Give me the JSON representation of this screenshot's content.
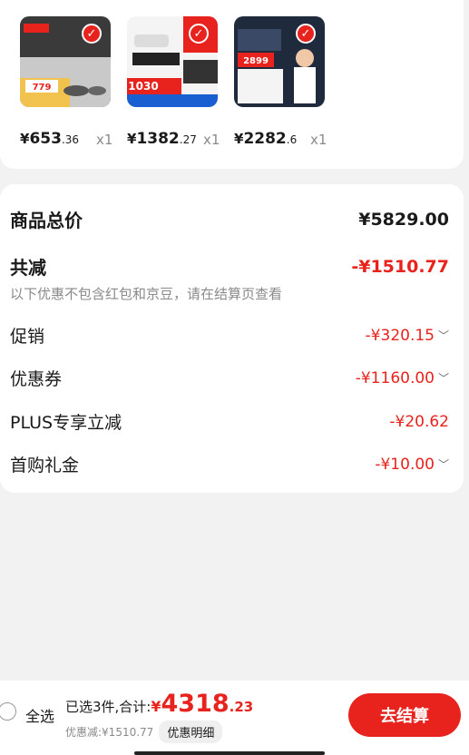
{
  "products": [
    {
      "cur": "¥",
      "int": "653",
      "dec": ".36",
      "qty": "x1",
      "thumb_label": "779"
    },
    {
      "cur": "¥",
      "int": "1382",
      "dec": ".27",
      "qty": "x1",
      "thumb_label": "1030"
    },
    {
      "cur": "¥",
      "int": "2282",
      "dec": ".6",
      "qty": "x1",
      "thumb_label": "2899"
    }
  ],
  "summary": {
    "total_label": "商品总价",
    "total_value": "¥5829.00",
    "reduce_label": "共减",
    "reduce_value": "-¥1510.77",
    "note": "以下优惠不包含红包和京豆，请在结算页查看",
    "items": [
      {
        "label": "促销",
        "value": "-¥320.15"
      },
      {
        "label": "优惠券",
        "value": "-¥1160.00"
      },
      {
        "label": "PLUS专享立减",
        "value": "-¥20.62"
      },
      {
        "label": "首购礼金",
        "value": "-¥10.00"
      }
    ]
  },
  "footer": {
    "select_all": "全选",
    "selected_total": "已选3件,合计:",
    "cur": "¥",
    "int": "4318",
    "dec": ".23",
    "discount": "优惠减:¥1510.77",
    "detail_btn": "优惠明细",
    "checkout": "去结算"
  },
  "colors": {
    "accent": "#e8231d"
  }
}
